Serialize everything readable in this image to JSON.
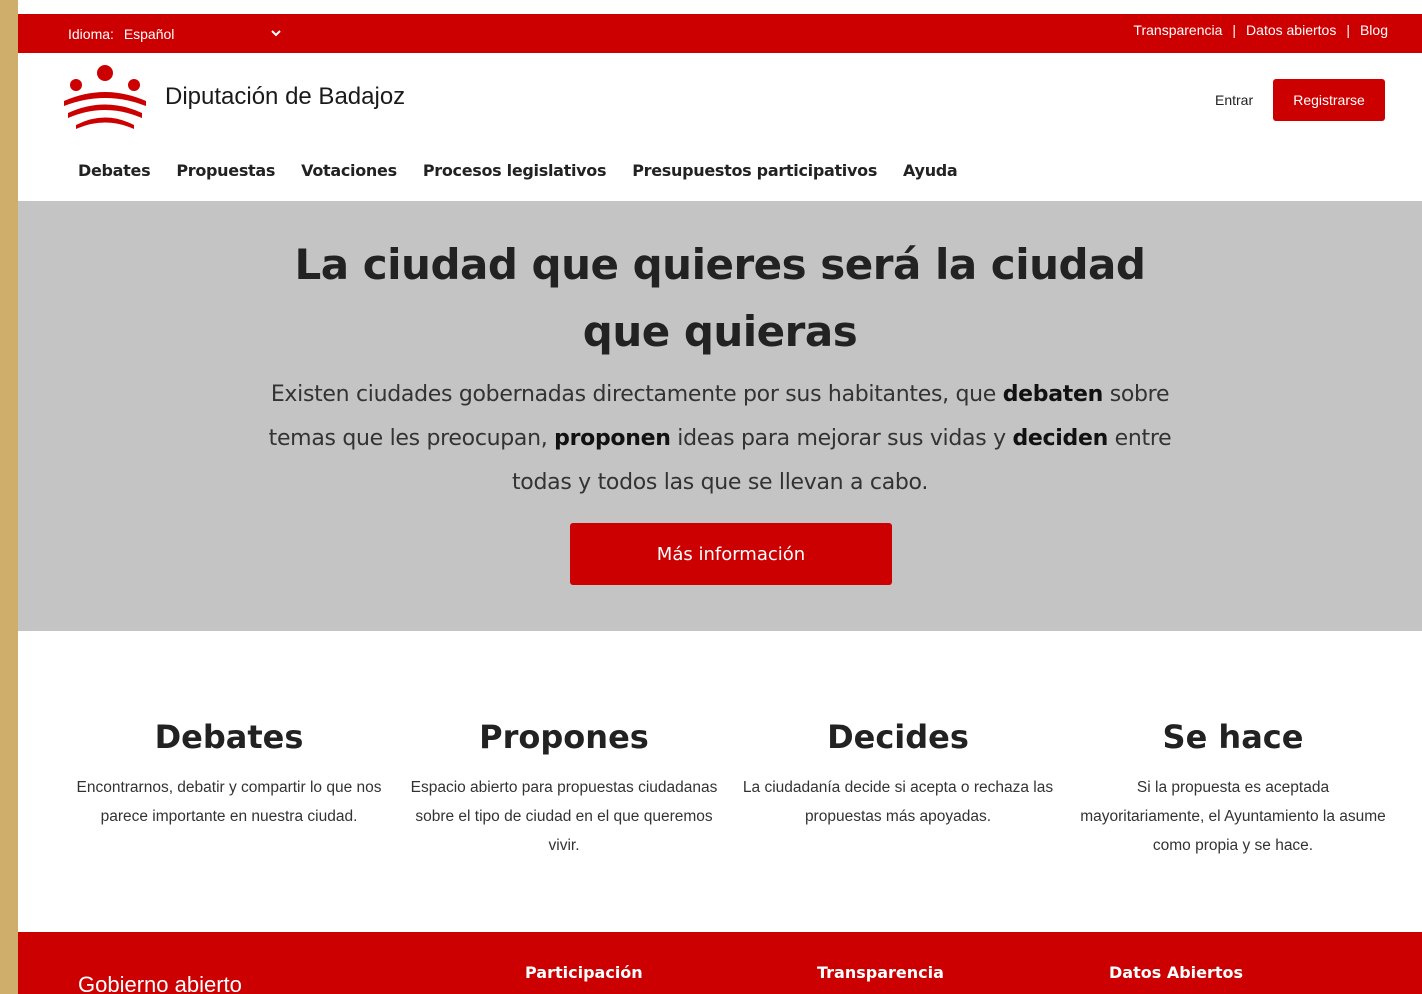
{
  "topbar": {
    "language_label": "Idioma:",
    "language_value": "Español",
    "links": [
      "Transparencia",
      "Datos abiertos",
      "Blog"
    ],
    "separator": "|"
  },
  "header": {
    "site_name": "Diputación de Badajoz",
    "login_label": "Entrar",
    "register_label": "Registrarse"
  },
  "nav": {
    "items": [
      "Debates",
      "Propuestas",
      "Votaciones",
      "Procesos legislativos",
      "Presupuestos participativos",
      "Ayuda"
    ]
  },
  "hero": {
    "title": "La ciudad que quieres será la ciudad que quieras",
    "text_1": "Existen ciudades gobernadas directamente por sus habitantes, que ",
    "bold_1": "debaten",
    "text_2": " sobre temas que les preocupan, ",
    "bold_2": "proponen",
    "text_3": " ideas para mejorar sus vidas y ",
    "bold_3": "deciden",
    "text_4": " entre todas y todos las que se llevan a cabo.",
    "button_label": "Más información"
  },
  "features": [
    {
      "title": "Debates",
      "text": "Encontrarnos, debatir y compartir lo que nos parece importante en nuestra ciudad."
    },
    {
      "title": "Propones",
      "text": "Espacio abierto para propuestas ciudadanas sobre el tipo de ciudad en el que queremos vivir."
    },
    {
      "title": "Decides",
      "text": "La ciudadanía decide si acepta o rechaza las propuestas más apoyadas."
    },
    {
      "title": "Se hace",
      "text": "Si la propuesta es aceptada mayoritariamente, el Ayuntamiento la asume como propia y se hace."
    }
  ],
  "footer": {
    "brand": "Gobierno abierto",
    "columns": [
      "Participación",
      "Transparencia",
      "Datos Abiertos"
    ]
  },
  "colors": {
    "brand_red": "#cc0000",
    "hero_bg": "#c4c4c4",
    "outer_frame": "#cfae6b"
  },
  "icons": {
    "logo": "diputacion-badajoz-logo",
    "language_dropdown": "chevron-down-icon"
  }
}
